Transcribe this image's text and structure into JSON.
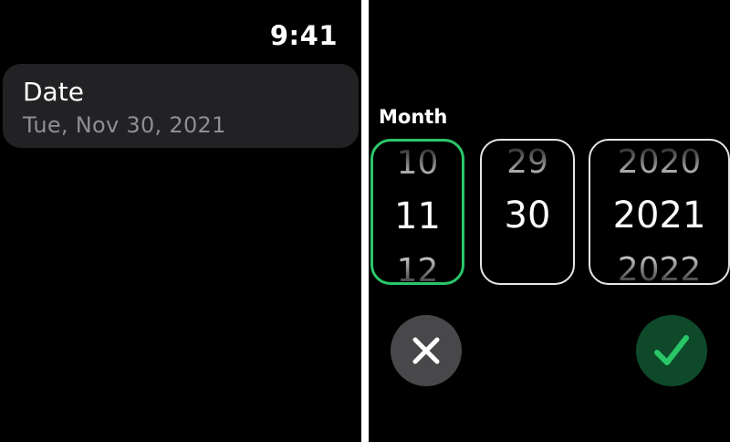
{
  "left_screen": {
    "status_time": "9:41",
    "date_cell": {
      "title": "Date",
      "value": "Tue, Nov 30, 2021"
    }
  },
  "right_screen": {
    "picker_label": "Month",
    "month_wheel": {
      "prev": "10",
      "current": "11",
      "next": "12"
    },
    "day_wheel": {
      "prev": "29",
      "current": "30",
      "next": ""
    },
    "year_wheel": {
      "prev": "2020",
      "current": "2021",
      "next": "2022"
    },
    "icons": {
      "cancel": "close-icon",
      "confirm": "checkmark-icon"
    }
  },
  "colors": {
    "accent_green": "#2ac769",
    "confirm_bg": "#0e4a2a",
    "cancel_bg": "#48484a",
    "cell_bg": "#222224",
    "secondary_text": "#8e8e93"
  }
}
